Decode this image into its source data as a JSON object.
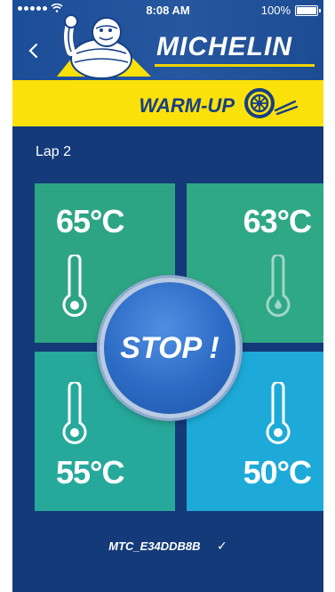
{
  "status_bar": {
    "time": "8:08 AM",
    "battery": "100%"
  },
  "header": {
    "brand": "MICHELIN",
    "back_icon": "chevron-left-icon"
  },
  "mode": {
    "label": "WARM-UP",
    "icon": "tire-wheel-icon"
  },
  "session": {
    "lap_label": "Lap 2"
  },
  "tires": {
    "front_left": {
      "temperature": "65°C",
      "color": "#2da584"
    },
    "front_right": {
      "temperature": "63°C",
      "color": "#2fa885"
    },
    "rear_left": {
      "temperature": "55°C",
      "color": "#26a99b"
    },
    "rear_right": {
      "temperature": "50°C",
      "color": "#1daad8"
    }
  },
  "actions": {
    "stop_label": "STOP !"
  },
  "device": {
    "id": "MTC_E34DDB8B",
    "status_icon": "check-icon"
  },
  "colors": {
    "background": "#143a79",
    "header": "#26579f",
    "band": "#fbe10a",
    "accent": "#163f86"
  }
}
